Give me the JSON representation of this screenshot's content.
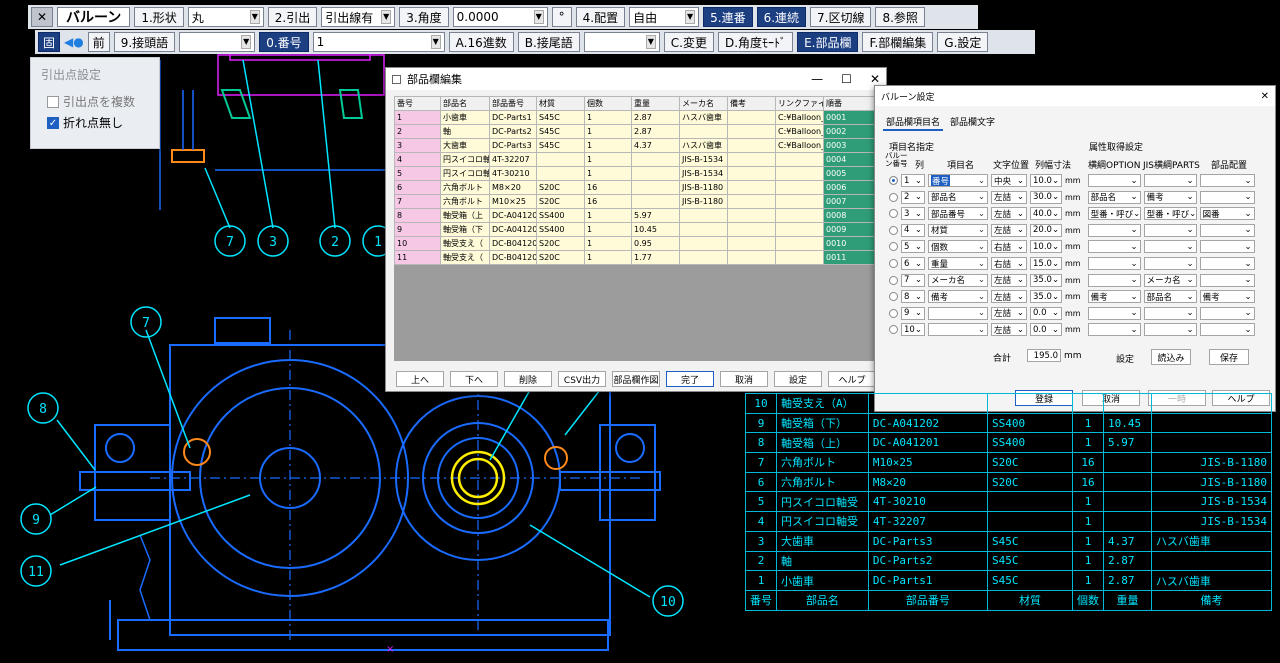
{
  "toolbar1": {
    "close_glyph": "✕",
    "title": "バルーン",
    "shape_btn": "1.形状",
    "shape_val": "丸",
    "leader_btn": "2.引出",
    "leader_val": "引出線有",
    "angle_btn": "3.角度",
    "angle_val": "0.0000",
    "degree": "°",
    "place_btn": "4.配置",
    "place_val": "自由",
    "serial_btn": "5.連番",
    "cont_btn": "6.連続",
    "sep_btn": "7.区切線",
    "ref_btn": "8.参照"
  },
  "toolbar2": {
    "fix_btn": "固",
    "prev_btn": "前",
    "prefix_btn": "9.接頭語",
    "prefix_val": "",
    "num_btn": "0.番号",
    "num_val": "1",
    "hex_btn": "A.16進数",
    "suffix_btn": "B.接尾語",
    "suffix_val": "",
    "change_btn": "C.変更",
    "anglemode_btn": "D.角度ﾓｰﾄﾞ",
    "partscol_btn": "E.部品欄",
    "partsedit_btn": "F.部欄編集",
    "settings_btn": "G.設定"
  },
  "leadpoint": {
    "title": "引出点設定",
    "opt1": "引出点を複数",
    "opt1_checked": false,
    "opt2": "折れ点無し",
    "opt2_checked": true
  },
  "parts_editor": {
    "title": "部品欄編集",
    "headers": [
      "番号",
      "部品名",
      "部品番号",
      "材質",
      "個数",
      "重量",
      "メーカ名",
      "備考",
      "リンクファイ",
      "順番"
    ],
    "rows": [
      [
        "1",
        "小歯車",
        "DC-Parts1",
        "S45C",
        "1",
        "2.87",
        "ハスバ歯車",
        "",
        "C:¥Balloon_",
        "0001"
      ],
      [
        "2",
        "軸",
        "DC-Parts2",
        "S45C",
        "1",
        "2.87",
        "",
        "",
        "C:¥Balloon_",
        "0002"
      ],
      [
        "3",
        "大歯車",
        "DC-Parts3",
        "S45C",
        "1",
        "4.37",
        "ハスバ歯車",
        "",
        "C:¥Balloon_",
        "0003"
      ],
      [
        "4",
        "円スイコロ軸",
        "4T-32207",
        "",
        "1",
        "",
        "JIS-B-1534",
        "",
        "",
        "0004"
      ],
      [
        "5",
        "円スイコロ軸",
        "4T-30210",
        "",
        "1",
        "",
        "JIS-B-1534",
        "",
        "",
        "0005"
      ],
      [
        "6",
        "六角ボルト",
        "M8×20",
        "S20C",
        "16",
        "",
        "JIS-B-1180",
        "",
        "",
        "0006"
      ],
      [
        "7",
        "六角ボルト",
        "M10×25",
        "S20C",
        "16",
        "",
        "JIS-B-1180",
        "",
        "",
        "0007"
      ],
      [
        "8",
        "軸受箱（上",
        "DC-A041201",
        "SS400",
        "1",
        "5.97",
        "",
        "",
        "",
        "0008"
      ],
      [
        "9",
        "軸受箱（下",
        "DC-A041202",
        "SS400",
        "1",
        "10.45",
        "",
        "",
        "",
        "0009"
      ],
      [
        "10",
        "軸受支え（",
        "DC-B041201",
        "S20C",
        "1",
        "0.95",
        "",
        "",
        "",
        "0010"
      ],
      [
        "11",
        "軸受支え（",
        "DC-B041202",
        "S20C",
        "1",
        "1.77",
        "",
        "",
        "",
        "0011"
      ]
    ],
    "buttons": [
      "上へ",
      "下へ",
      "削除",
      "CSV出力",
      "部品欄作図",
      "完了",
      "取消",
      "設定",
      "ヘルプ"
    ]
  },
  "balloon_settings": {
    "title": "バルーン設定",
    "tabs": [
      "部品欄項目名",
      "部品欄文字"
    ],
    "group_left": "項目名指定",
    "group_right": "属性取得設定",
    "col_balloon": "バルーン番号",
    "col_col": "列",
    "col_item": "項目名",
    "col_pos": "文字位置",
    "col_width": "列幅寸法",
    "col_opt": "横綱OPTION",
    "col_jis": "JIS横綱PARTS",
    "col_place": "部品配置",
    "unit": "mm",
    "rows": [
      {
        "n": "1",
        "item": "番号",
        "pos": "中央",
        "w": "10.0",
        "opt": "",
        "jis": "",
        "place": ""
      },
      {
        "n": "2",
        "item": "部品名",
        "pos": "左詰",
        "w": "30.0",
        "opt": "部品名",
        "jis": "備考",
        "place": ""
      },
      {
        "n": "3",
        "item": "部品番号",
        "pos": "左詰",
        "w": "40.0",
        "opt": "型番・呼び",
        "jis": "型番・呼び",
        "place": "図番"
      },
      {
        "n": "4",
        "item": "材質",
        "pos": "左詰",
        "w": "20.0",
        "opt": "",
        "jis": "",
        "place": ""
      },
      {
        "n": "5",
        "item": "個数",
        "pos": "右詰",
        "w": "10.0",
        "opt": "",
        "jis": "",
        "place": ""
      },
      {
        "n": "6",
        "item": "重量",
        "pos": "右詰",
        "w": "15.0",
        "opt": "",
        "jis": "",
        "place": ""
      },
      {
        "n": "7",
        "item": "メーカ名",
        "pos": "左詰",
        "w": "35.0",
        "opt": "",
        "jis": "メーカ名",
        "place": ""
      },
      {
        "n": "8",
        "item": "備考",
        "pos": "左詰",
        "w": "35.0",
        "opt": "備考",
        "jis": "部品名",
        "place": "備考"
      },
      {
        "n": "9",
        "item": "",
        "pos": "左詰",
        "w": "0.0",
        "opt": "",
        "jis": "",
        "place": ""
      },
      {
        "n": "10",
        "item": "",
        "pos": "左詰",
        "w": "0.0",
        "opt": "",
        "jis": "",
        "place": ""
      }
    ],
    "total_label": "合計",
    "total_val": "195.0",
    "set_label": "設定",
    "load_btn": "読込み",
    "save_btn": "保存",
    "ok_btn": "登録",
    "cancel_btn": "取消",
    "temp_btn": "一時",
    "help_btn": "ヘルプ"
  },
  "bom_table": {
    "rows": [
      [
        "10",
        "軸受支え（A）",
        "",
        "",
        "",
        "",
        ""
      ],
      [
        "9",
        "軸受箱（下）",
        "DC-A041202",
        "SS400",
        "1",
        "10.45",
        ""
      ],
      [
        "8",
        "軸受箱（上）",
        "DC-A041201",
        "SS400",
        "1",
        "5.97",
        ""
      ],
      [
        "7",
        "六角ボルト",
        "M10×25",
        "S20C",
        "16",
        "",
        "JIS-B-1180"
      ],
      [
        "6",
        "六角ボルト",
        "M8×20",
        "S20C",
        "16",
        "",
        "JIS-B-1180"
      ],
      [
        "5",
        "円スイコロ軸受",
        "4T-30210",
        "",
        "1",
        "",
        "JIS-B-1534"
      ],
      [
        "4",
        "円スイコロ軸受",
        "4T-32207",
        "",
        "1",
        "",
        "JIS-B-1534"
      ],
      [
        "3",
        "大歯車",
        "DC-Parts3",
        "S45C",
        "1",
        "4.37",
        "ハスバ歯車"
      ],
      [
        "2",
        "軸",
        "DC-Parts2",
        "S45C",
        "1",
        "2.87",
        ""
      ],
      [
        "1",
        "小歯車",
        "DC-Parts1",
        "S45C",
        "1",
        "2.87",
        "ハスバ歯車"
      ]
    ],
    "header": [
      "番号",
      "部品名",
      "部品番号",
      "材質",
      "個数",
      "重量",
      "備考"
    ]
  },
  "balloons": [
    "7",
    "3",
    "2",
    "1",
    "7",
    "8",
    "9",
    "11",
    "10"
  ],
  "colors": {
    "cad_blue": "#1a6bff",
    "cad_cyan": "#00e6ff",
    "cad_yellow": "#ffee00",
    "cad_orange": "#ff8a1a",
    "cad_magenta": "#e020ff",
    "toolbar_blue": "#1c3f82"
  }
}
